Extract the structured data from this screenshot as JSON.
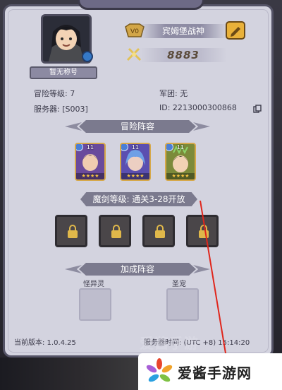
{
  "profile": {
    "title_tag": "暂无称号",
    "vip_badge": "V0",
    "player_name": "宾姆堡战神",
    "power": "8883"
  },
  "info": {
    "adventure_level": "冒险等级: 7",
    "guild": "军团: 无",
    "server": "服务器: [S003]",
    "player_id": "ID: 2213000300868"
  },
  "sections": {
    "lineup_title": "冒险阵容",
    "sword_level": "魔剑等级: 通关3-28开放",
    "bonus_title": "加成阵容",
    "bonus_left_label": "怪异灵",
    "bonus_right_label": "圣宠"
  },
  "heroes": [
    {
      "level": "11",
      "stars": "★★★★",
      "color": "#6a4a9c"
    },
    {
      "level": "11",
      "stars": "★★★★",
      "color": "#5b4fb0"
    },
    {
      "level": "11",
      "stars": "★★★★",
      "color": "#7c8a3a"
    }
  ],
  "footer": {
    "version": "当前版本: 1.0.4.25",
    "server_time": "服务器时间: (UTC +8) 15:14:20"
  },
  "watermark": {
    "brand_text": "爱酱手游网",
    "faint_text": "爱酱手游"
  },
  "colors": {
    "panel": "#d3d3df",
    "accent_gold": "#e9b13a",
    "arrow": "#e0261c"
  },
  "icons": [
    "vip-badge-icon",
    "edit-icon",
    "power-icon",
    "copy-icon",
    "settings-gear-icon",
    "lock-icon",
    "brand-logo-icon"
  ]
}
